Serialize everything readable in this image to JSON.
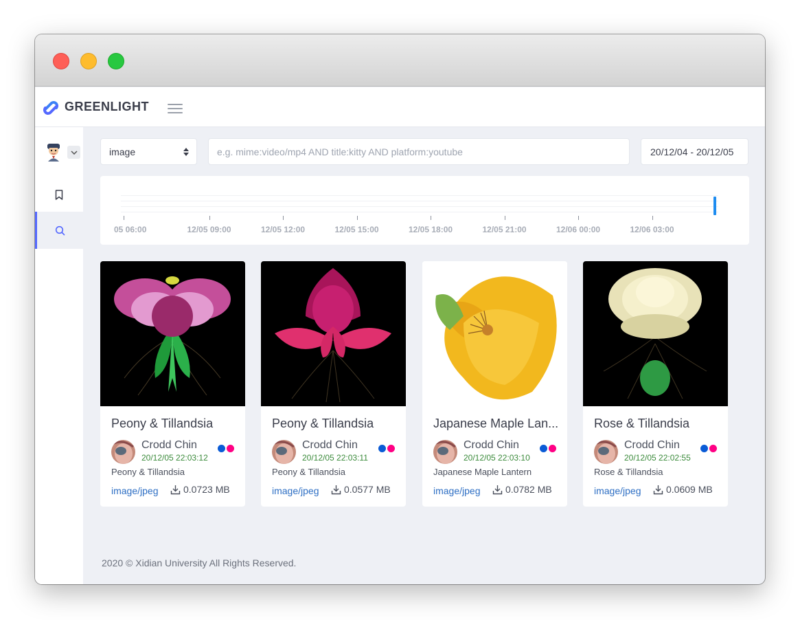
{
  "app": {
    "brand": "GREENLIGHT",
    "brand_color": "#5468ff"
  },
  "toolbar": {
    "media_type": "image",
    "query_placeholder": "e.g. mime:video/mp4 AND title:kitty AND platform:youtube",
    "query_value": "",
    "date_range": "20/12/04 - 20/12/05"
  },
  "sidebar": {
    "items": [
      {
        "icon": "bookmark-icon",
        "active": false
      },
      {
        "icon": "search-icon",
        "active": true
      }
    ]
  },
  "timeline": {
    "labels": [
      "05 06:00",
      "12/05 09:00",
      "12/05 12:00",
      "12/05 15:00",
      "12/05 18:00",
      "12/05 21:00",
      "12/06 00:00",
      "12/06 03:00"
    ],
    "bar_color": "#1e8cf0"
  },
  "cards": [
    {
      "title": "Peony & Tillandsia",
      "author": "Crodd Chin",
      "time": "20/12/05 22:03:12",
      "description": "Peony & Tillandsia",
      "mime": "image/jpeg",
      "size": "0.0723 MB"
    },
    {
      "title": "Peony & Tillandsia",
      "author": "Crodd Chin",
      "time": "20/12/05 22:03:11",
      "description": "Peony & Tillandsia",
      "mime": "image/jpeg",
      "size": "0.0577 MB"
    },
    {
      "title": "Japanese Maple Lan...",
      "author": "Crodd Chin",
      "time": "20/12/05 22:03:10",
      "description": "Japanese Maple Lantern",
      "mime": "image/jpeg",
      "size": "0.0782 MB"
    },
    {
      "title": "Rose & Tillandsia",
      "author": "Crodd Chin",
      "time": "20/12/05 22:02:55",
      "description": "Rose & Tillandsia",
      "mime": "image/jpeg",
      "size": "0.0609 MB"
    }
  ],
  "footer": {
    "text": "2020 © Xidian University All Rights Reserved."
  }
}
